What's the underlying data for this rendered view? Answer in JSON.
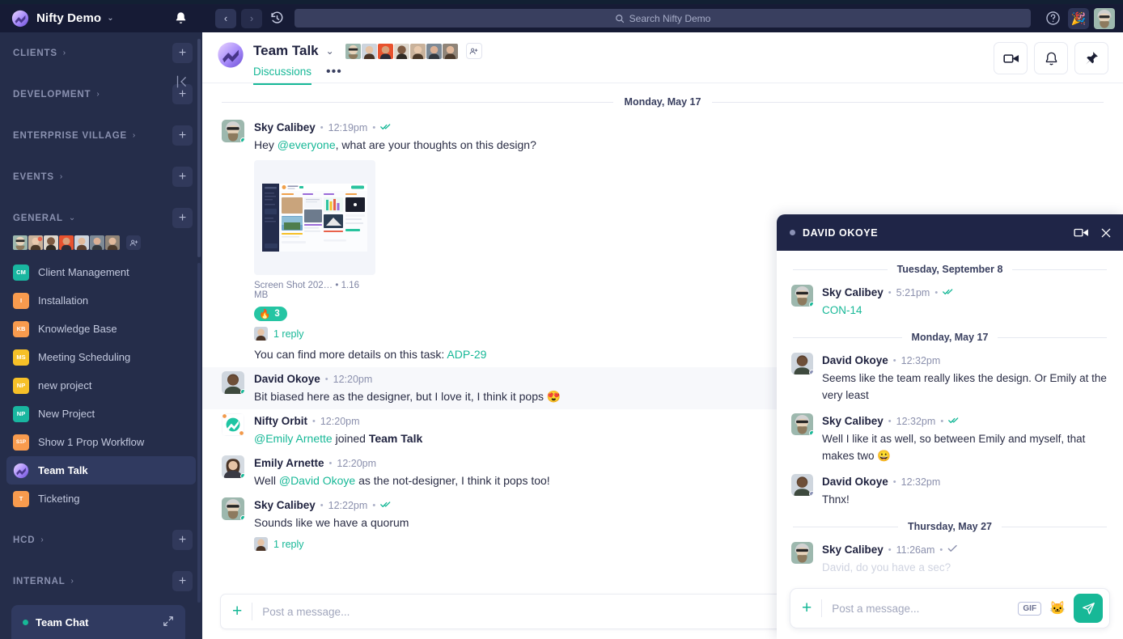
{
  "topbar": {
    "brand": "Nifty Demo",
    "brand_caret": "⌄",
    "bell_icon": "bell-icon",
    "back_icon": "‹",
    "forward_icon": "›",
    "history_icon": "history-icon",
    "search_placeholder": "Search Nifty Demo",
    "help_icon": "?",
    "party_icon": "🎉",
    "avatar": "user-avatar"
  },
  "sidebar": {
    "collapse_icon": "collapse-sidebar-icon",
    "add_icon": "+",
    "groups": [
      {
        "label": "CLIENTS",
        "caret": "›",
        "expanded": false
      },
      {
        "label": "DEVELOPMENT",
        "caret": "›",
        "expanded": false
      },
      {
        "label": "ENTERPRISE VILLAGE",
        "caret": "›",
        "expanded": false
      },
      {
        "label": "EVENTS",
        "caret": "›",
        "expanded": false
      },
      {
        "label": "GENERAL",
        "caret": "⌄",
        "expanded": true
      }
    ],
    "tail_groups": [
      {
        "label": "HCD",
        "caret": "›"
      },
      {
        "label": "INTERNAL",
        "caret": "›"
      }
    ],
    "projects": [
      {
        "label": "Client Management",
        "initials": "CM",
        "color": "#19b6a0"
      },
      {
        "label": "Installation",
        "initials": "I",
        "color": "#f89b4e"
      },
      {
        "label": "Knowledge Base",
        "initials": "KB",
        "color": "#f89b4e"
      },
      {
        "label": "Meeting Scheduling",
        "initials": "MS",
        "color": "#f6c028"
      },
      {
        "label": "new project",
        "initials": "NP",
        "color": "#f6c028"
      },
      {
        "label": "New Project",
        "initials": "NP",
        "color": "#19b6a0"
      },
      {
        "label": "Show 1 Prop Workflow",
        "initials": "S1P",
        "color": "#f89b4e"
      },
      {
        "label": "Team Talk",
        "initials": "",
        "color": "#8b5cf6",
        "active": true,
        "logo": true
      },
      {
        "label": "Ticketing",
        "initials": "T",
        "color": "#f89b4e"
      }
    ],
    "team_chat": {
      "label": "Team Chat",
      "status": "online",
      "expand_icon": "expand-icon"
    }
  },
  "channel": {
    "title": "Team Talk",
    "caret": "⌄",
    "tabs": [
      {
        "label": "Discussions",
        "active": true
      }
    ],
    "more_icon": "•••",
    "add_member_icon": "add-person-icon",
    "actions": [
      {
        "name": "video-call-button",
        "icon": "video-icon"
      },
      {
        "name": "notifications-button",
        "icon": "bell-icon"
      },
      {
        "name": "pin-button",
        "icon": "pin-icon"
      }
    ]
  },
  "conversation": {
    "day_separator": "Monday, May 17",
    "messages": [
      {
        "author": "Sky Calibey",
        "time": "12:19pm",
        "dot": "•",
        "read_state": "double-check",
        "presence": "online",
        "text_parts": [
          {
            "t": "Hey "
          },
          {
            "t": "@everyone",
            "k": "mention"
          },
          {
            "t": ", what are your thoughts on this design?"
          }
        ],
        "attachment": {
          "name": "Screen Shot 202…",
          "sep": "•",
          "size": "1.16 MB"
        },
        "reaction": {
          "emoji": "🔥",
          "count": "3"
        },
        "replies": "1 reply",
        "followup_parts": [
          {
            "t": "You can find more details on this task: "
          },
          {
            "t": "ADP-29",
            "k": "link"
          }
        ]
      },
      {
        "author": "David Okoye",
        "time": "12:20pm",
        "dot": "•",
        "presence": "online",
        "highlight": true,
        "text_parts": [
          {
            "t": "Bit biased here as the designer, but I love it, I think it pops 😍"
          }
        ]
      },
      {
        "author": "Nifty Orbit",
        "time": "12:20pm",
        "dot": "•",
        "bot": true,
        "text_parts": [
          {
            "t": "@Emily Arnette",
            "k": "mention"
          },
          {
            "t": " joined "
          },
          {
            "t": "Team Talk",
            "k": "bold"
          }
        ]
      },
      {
        "author": "Emily Arnette",
        "time": "12:20pm",
        "dot": "•",
        "presence": "online",
        "text_parts": [
          {
            "t": "Well "
          },
          {
            "t": "@David Okoye",
            "k": "mention"
          },
          {
            "t": " as the not-designer, I think it pops too!"
          }
        ]
      },
      {
        "author": "Sky Calibey",
        "time": "12:22pm",
        "dot": "•",
        "read_state": "double-check",
        "presence": "online",
        "text_parts": [
          {
            "t": "Sounds like we have a quorum"
          }
        ],
        "replies": "1 reply"
      }
    ],
    "composer": {
      "placeholder": "Post a message...",
      "plus_icon": "+"
    }
  },
  "dm_panel": {
    "title": "DAVID OKOYE",
    "status": "away",
    "video_icon": "video-icon",
    "close_icon": "✕",
    "blocks": [
      {
        "type": "day",
        "label": "Tuesday, September 8"
      },
      {
        "type": "msg",
        "author": "Sky Calibey",
        "time": "5:21pm",
        "dot": "•",
        "read_state": "double-check",
        "presence": "online",
        "text_parts": [
          {
            "t": "CON-14",
            "k": "link"
          }
        ]
      },
      {
        "type": "day",
        "label": "Monday, May 17"
      },
      {
        "type": "msg",
        "author": "David Okoye",
        "time": "12:32pm",
        "dot": "•",
        "presence": "away",
        "text_parts": [
          {
            "t": "Seems like the team really likes the design. Or Emily at the very least"
          }
        ]
      },
      {
        "type": "msg",
        "author": "Sky Calibey",
        "time": "12:32pm",
        "dot": "•",
        "read_state": "double-check",
        "presence": "online",
        "text_parts": [
          {
            "t": "Well I like it as well, so between Emily and myself, that makes two 😀"
          }
        ]
      },
      {
        "type": "msg",
        "author": "David Okoye",
        "time": "12:32pm",
        "dot": "•",
        "presence": "away",
        "text_parts": [
          {
            "t": "Thnx!"
          }
        ]
      },
      {
        "type": "day",
        "label": "Thursday, May 27"
      },
      {
        "type": "msg",
        "author": "Sky Calibey",
        "time": "11:26am",
        "dot": "•",
        "read_state": "single-check",
        "presence": "online",
        "fading": true,
        "text_parts": [
          {
            "t": "David, do you have a sec?"
          }
        ]
      }
    ],
    "composer": {
      "placeholder": "Post a message...",
      "plus_icon": "+",
      "gif_label": "GIF",
      "sticker_icon": "🐱",
      "send_icon": "send-icon"
    }
  },
  "colors": {
    "accent_teal": "#17b897",
    "sidebar_bg": "#252d4a",
    "topbar_bg": "#161b35",
    "dm_header_bg": "#1f2547",
    "brand_purple": "#8b5cf6"
  }
}
